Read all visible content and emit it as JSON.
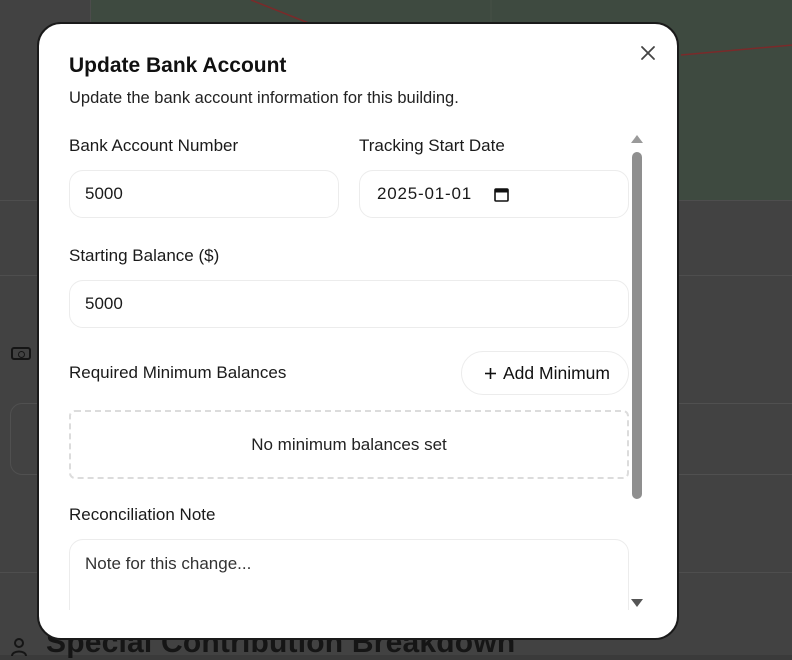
{
  "dialog": {
    "title": "Update Bank Account",
    "description": "Update the bank account information for this building.",
    "close_icon": "close-icon"
  },
  "form": {
    "bank_account_number": {
      "label": "Bank Account Number",
      "value": "5000"
    },
    "tracking_start_date": {
      "label": "Tracking Start Date",
      "value": "2025-01-01",
      "icon": "calendar-icon"
    },
    "starting_balance": {
      "label": "Starting Balance ($)",
      "value": "5000"
    },
    "minimum_balances": {
      "label": "Required Minimum Balances",
      "add_button": "Add Minimum",
      "add_icon": "plus-icon",
      "empty_text": "No minimum balances set"
    },
    "reconciliation_note": {
      "label": "Reconciliation Note",
      "placeholder": "Note for this change..."
    }
  },
  "background": {
    "section_heading": "Special Contribution Breakdown"
  }
}
